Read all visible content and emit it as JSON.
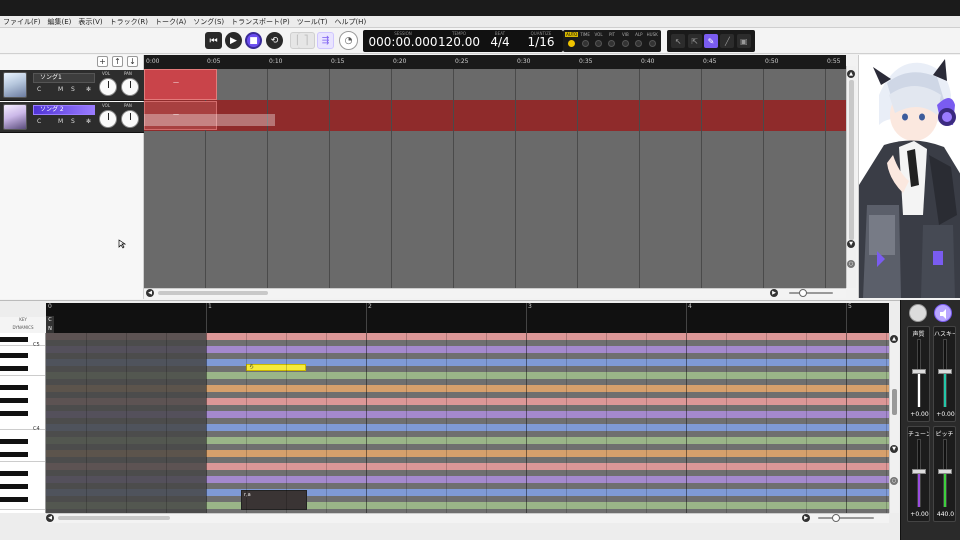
{
  "menu": [
    "ファイル(F)",
    "編集(E)",
    "表示(V)",
    "トラック(R)",
    "トーク(A)",
    "ソング(S)",
    "トランスポート(P)",
    "ツール(T)",
    "ヘルプ(H)"
  ],
  "counter": {
    "session_label": "SESSION",
    "session_value": "000:00.000",
    "tempo_label": "TEMPO",
    "tempo_value": "120.00",
    "beat_label": "BEAT",
    "beat_value": "4/4",
    "quantize_label": "QUANTIZE",
    "quantize_value": "1/16"
  },
  "mix_labels": [
    "AUTO",
    "TIME",
    "VOL",
    "PIT",
    "VIB",
    "ALP",
    "HUSK"
  ],
  "track_buttons": [
    "+",
    "↑",
    "↓"
  ],
  "tracks": [
    {
      "name": "ソング1",
      "c": "C",
      "m": "M",
      "s": "S",
      "fx": "✻",
      "vol_label": "VOL",
      "pan_label": "PAN"
    },
    {
      "name": "ソング 2",
      "c": "C",
      "m": "M",
      "s": "S",
      "fx": "✻",
      "vol_label": "VOL",
      "pan_label": "PAN"
    }
  ],
  "ruler": [
    "0:00",
    "0:05",
    "0:10",
    "0:15",
    "0:20",
    "0:25",
    "0:30",
    "0:35",
    "0:40",
    "0:45",
    "0:50",
    "0:55"
  ],
  "regions": [
    {
      "label": "—"
    },
    {
      "label": "—"
    }
  ],
  "pianoroll": {
    "key_label": "KEY",
    "dynamics_label": "DYNAMICS",
    "key_row": "C",
    "dyn_row": "N",
    "bars": [
      "0",
      "1",
      "2",
      "3",
      "4",
      "5"
    ],
    "key_names": [
      "C5",
      "C4"
    ],
    "note_lyric": "ら",
    "phoneme_box": "r,a"
  },
  "params": [
    {
      "label": "声質",
      "value": "+0.00",
      "color": "#ffffff"
    },
    {
      "label": "ハスキー",
      "value": "+0.00",
      "color": "#22c7a8"
    },
    {
      "label": "チューン",
      "value": "+0.00",
      "color": "#9a4de0"
    },
    {
      "label": "ピッチ",
      "value": "440.0",
      "color": "#3ccf3c"
    }
  ],
  "colors": {
    "accent": "#7a5cf0",
    "region_red": "#b53a3a",
    "note_yellow": "#f6ea3a"
  }
}
